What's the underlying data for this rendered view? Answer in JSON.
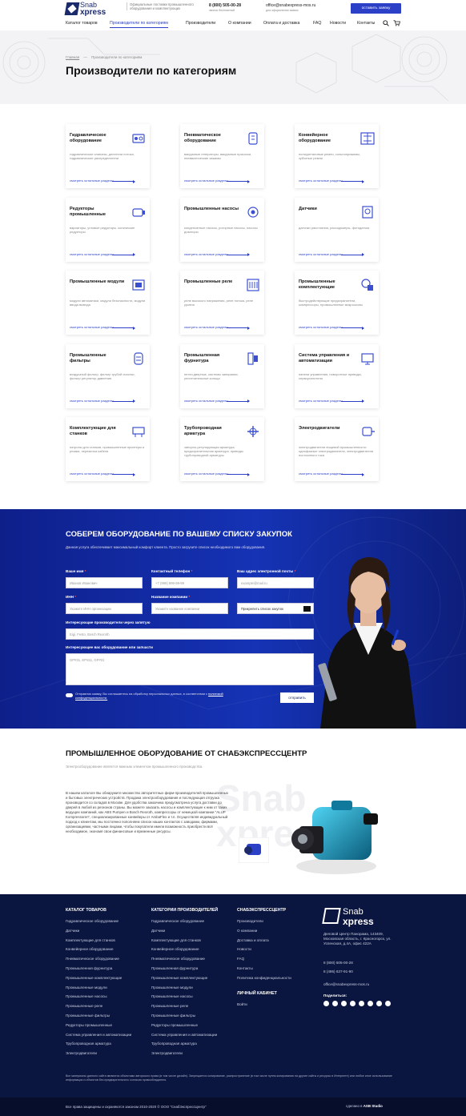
{
  "header": {
    "logo_top": "Snab",
    "logo_bottom": "xpress",
    "tagline": "Официальные поставки промышленного оборудования и комплектующих",
    "phone": "8 (800) 505-00-28",
    "phone_sub": "звонок бесплатный",
    "email": "office@snabexpress-mos.ru",
    "email_sub": "для оформления заявок",
    "cta": "оставить заявку"
  },
  "nav": [
    "Каталог товаров",
    "Производители по категориям",
    "Производители",
    "О компании",
    "Оплата и доставка",
    "FAQ",
    "Новости",
    "Контакты"
  ],
  "breadcrumb": {
    "home": "Главная",
    "sep": "—",
    "current": "Производители по категориям"
  },
  "page_title": "Производители по категориям",
  "link_more": "смотреть остальные разделы",
  "cards": [
    {
      "title": "Гидравлическое оборудование",
      "desc": "гидравлические клапаны, делители потока, гидравлические распределители",
      "icon": "hydraulic-icon"
    },
    {
      "title": "Пневматическое оборудование",
      "desc": "вакуумные генераторы, вакуумные присоски, пневматические зажимы",
      "icon": "pneumatic-icon"
    },
    {
      "title": "Конвейерное оборудование",
      "desc": "полиуретановые ремни, сольноприжимы, зубчатые ремни",
      "icon": "conveyor-icon"
    },
    {
      "title": "Редукторы промышленные",
      "desc": "вариаторы, угловые редукторы, конические редукторы",
      "icon": "gearbox-icon"
    },
    {
      "title": "Промышленные насосы",
      "desc": "конденсатные насосы, роторные насосы, насосы дозаторы",
      "icon": "pump-icon"
    },
    {
      "title": "Датчики",
      "desc": "датчики расстояния, расходомеры, фотодатчик",
      "icon": "sensor-icon"
    },
    {
      "title": "Промышленные модули",
      "desc": "модули автоматики, модули безопасности, модули ввода вывода",
      "icon": "module-icon"
    },
    {
      "title": "Промышленные реле",
      "desc": "реле высокого напряжения, реле потока, реле уровня",
      "icon": "relay-icon"
    },
    {
      "title": "Промышленные комплектующие",
      "desc": "быстродействующие предохранители, компрессоры, промышленные микроскопы",
      "icon": "components-icon"
    },
    {
      "title": "Промышленные фильтры",
      "desc": "воздушный фильтр, фильтр грубой очистки, фильтр регулятор давления",
      "icon": "filter-icon"
    },
    {
      "title": "Промышленная фурнитура",
      "desc": "петли дверные, системы запирания, уплотнительные кольца",
      "icon": "fittings-icon"
    },
    {
      "title": "Система управления и автоматизации",
      "desc": "панели управления, поворотные приводы, сервоусилители",
      "icon": "automation-icon"
    },
    {
      "title": "Комплектующие для станков",
      "desc": "патроны для станков, промышленные принтеры и резаки, перемотка кабеля",
      "icon": "machine-icon"
    },
    {
      "title": "Трубопроводная арматура",
      "desc": "запорно-регулирующая арматура, предохранительная арматура, приводы трубопроводной арматуры",
      "icon": "valve-icon"
    },
    {
      "title": "Электродвигатели",
      "desc": "электродвигатели пищевой промышленности однофазные электродвигатели, электродвигатели постоянного тока",
      "icon": "motor-icon"
    }
  ],
  "form": {
    "title": "СОБЕРЕМ ОБОРУДОВАНИЕ ПО ВАШЕМУ СПИСКУ ЗАКУПОК",
    "subtitle": "Данная услуга обеспечивает максимальный комфорт клиента. Просто загрузите список необходимого вам оборудования.",
    "name_label": "Ваше имя",
    "name_ph": "Иванов Иванович",
    "phone_label": "Контактный телефон",
    "phone_ph": "+7 (999) 999-99-99",
    "email_label": "Ваш адрес электронной почты",
    "email_ph": "example@mail.ru",
    "inn_label": "ИНН",
    "inn_ph": "Укажите ИНН организации",
    "company_label": "Название компании",
    "company_ph": "Укажите название компании",
    "attach": "Прикрепить список закупок",
    "makers_label": "Интересующие производители через запятую",
    "makers_ph": "Eigi, Festo, Bosch Rexroth",
    "items_label": "Интересующее вас оборудование или запчасти",
    "items_ph": "GP#31, EPS11, GP#31",
    "agree": "Отправляя заявку, Вы соглашаетесь на обработку персональных данных, в соответствии с",
    "agree_link": "политикой конфиденциальности.",
    "submit": "отправить",
    "asterisk": "*"
  },
  "about": {
    "title": "ПРОМЫШЛЕННОЕ ОБОРУДОВАНИЕ ОТ СНАБЭКСПРЕССЦЕНТР",
    "subtitle": "Электрооборудование является важным элементом промышленного производства.",
    "text": "В нашем каталоге Вы обнаружите множество авторитетных фирм-производителей промышленных и бытовых электрических устройств. Продажа электрооборудования и последующая отгрузка производится со складов в Москве. Для удобства заказчика предусмотрена услуга доставки до дверей в любой из регионов страны. Вы можете заказать насосы и комплектующие к ним от таких ведущих компаний, как ABS Pumpen и Bosch Rexroth, компрессоры от немецкой компании \"ALUP Kompressoren\", специализированные конвейеры от AmbaFlex и т.п. Осуществляя индивидуальный подход к клиентам, мы постоянно пополняем список наших контактов с заводами, фирмами, организациями, частными лицами, чтобы покупатели имели возможность приобрести всё необходимое, экономя свои финансовые и временные ресурсы.",
    "watermark_1": "Snab",
    "watermark_2": "xpress"
  },
  "footer": {
    "col1_title": "КАТАЛОГ ТОВАРОВ",
    "col1": [
      "Гидравлическое оборудование",
      "Датчики",
      "Комплектующие для станков",
      "Конвейерное оборудование",
      "Пневматическое оборудование",
      "Промышленная фурнитура",
      "Промышленные комплектующие",
      "Промышленные модули",
      "Промышленные насосы",
      "Промышленные реле",
      "Промышленные фильтры",
      "Редукторы промышленные",
      "Система управления и автоматизации",
      "Трубопроводная арматура",
      "Электродвигатели"
    ],
    "col2_title": "КАТЕГОРИИ ПРОИЗВОДИТЕЛЕЙ",
    "col2": [
      "Гидравлическое оборудование",
      "Датчики",
      "Комплектующие для станков",
      "Конвейерное оборудование",
      "Пневматическое оборудование",
      "Промышленная фурнитура",
      "Промышленные комплектующие",
      "Промышленные модули",
      "Промышленные насосы",
      "Промышленные реле",
      "Промышленные фильтры",
      "Редукторы промышленные",
      "Система управления и автоматизации",
      "Трубопроводная арматура",
      "Электродвигатели"
    ],
    "col3_title": "СНАБЭКСПРЕССЦЕНТР",
    "col3": [
      "Производители",
      "О компании",
      "Доставка и оплата",
      "Новости",
      "FAQ",
      "Контакты",
      "Политика конфиденциальности"
    ],
    "cabinet_title": "ЛИЧНЫЙ КАБИНЕТ",
    "cabinet_login": "Войти",
    "logo_top": "Snab",
    "logo_bottom": "xpress",
    "address": "Деловой Центр Панорама, 143409, Московская область, г. Красногорск, ул. Успенская, д.4А, офис 422А",
    "phone1": "8 (800) 505-00-28",
    "phone2": "8 (495) 637-91-90",
    "email": "office@snabexpress-mos.ru",
    "share": "Поделиться:",
    "copyright": "Все материалы данного сайта являются объектами авторского права (в том числе дизайн). Запрещается копирование, распространение (в том числе путем копирования на другие сайты и ресурсы в Интернете) или любое иное использование информации и объектов без предварительного согласия правообладателя.",
    "rights": "Все права защищены и охраняются законом 2010-2020 © ООО \"СнабЭкспрессЦентр\"",
    "made_by": "сделано в",
    "studio": "ASB Studio"
  },
  "colors": {
    "accent": "#2b3fc7",
    "dark": "#0b1640",
    "blue_band": "#1533b5"
  }
}
